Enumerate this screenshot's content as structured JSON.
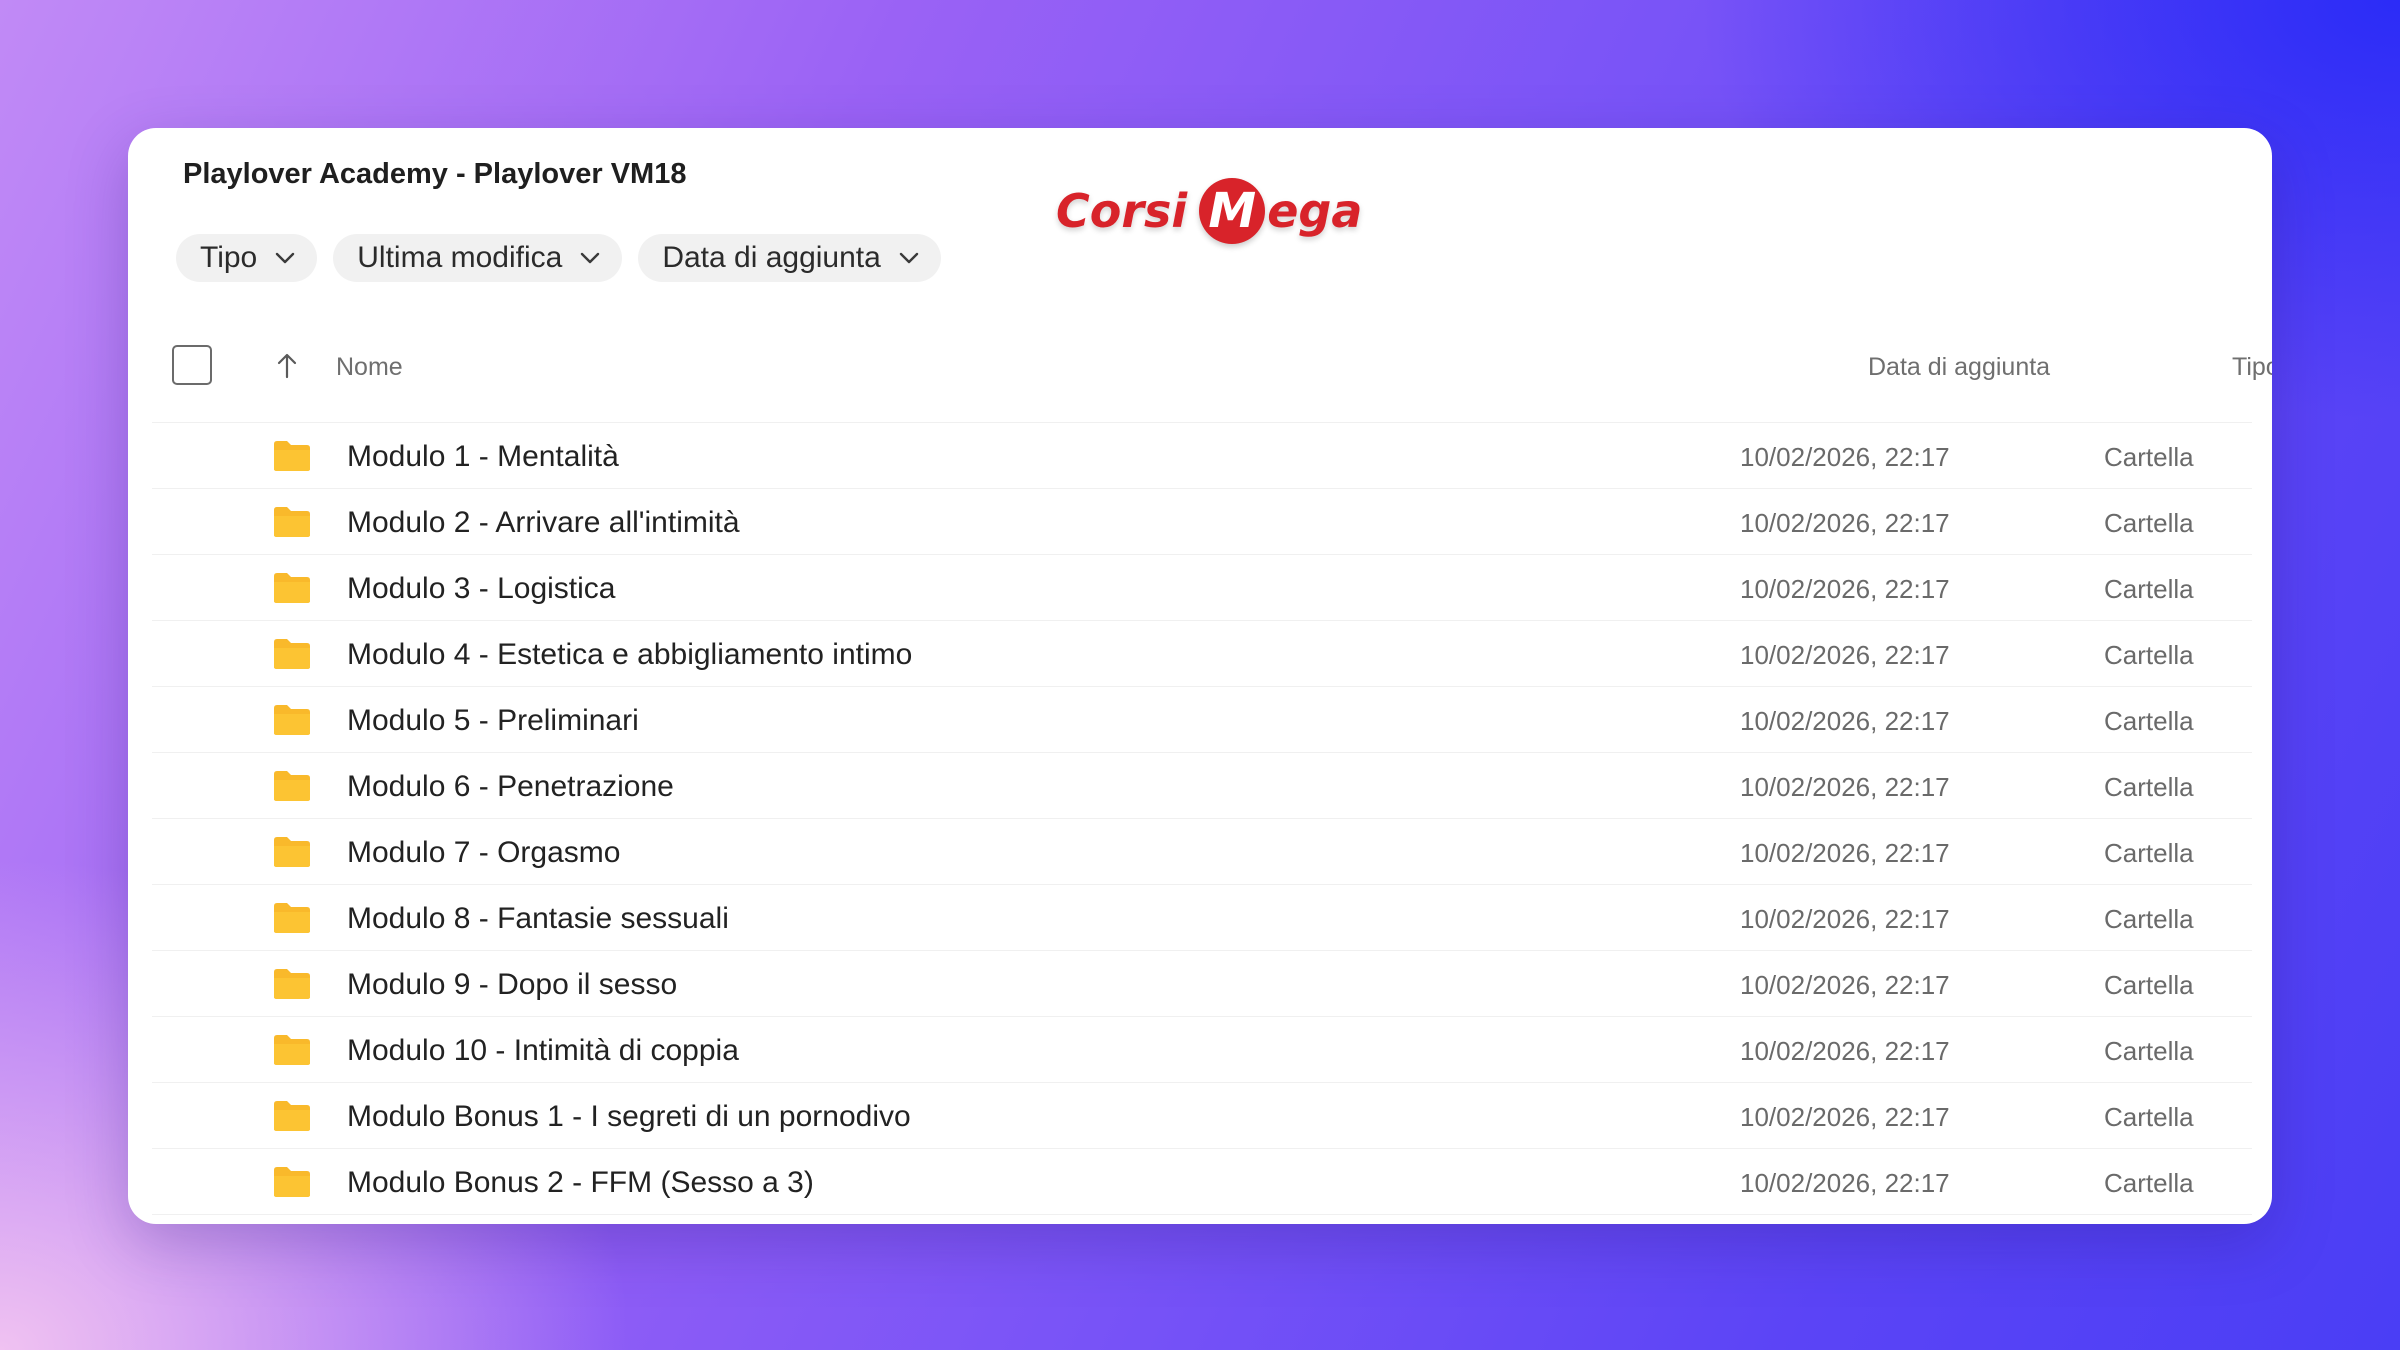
{
  "panel": {
    "title": "Playlover Academy - Playlover VM18"
  },
  "logo": {
    "word1": "Corsi",
    "m_letter": "M",
    "word2": "ega",
    "color": "#d8232a"
  },
  "filters": [
    {
      "label": "Tipo",
      "icon": "chevron-down-icon"
    },
    {
      "label": "Ultima modifica",
      "icon": "chevron-down-icon"
    },
    {
      "label": "Data di aggiunta",
      "icon": "chevron-down-icon"
    }
  ],
  "table": {
    "columns": {
      "name": "Nome",
      "date_added": "Data di aggiunta",
      "type": "Tipo"
    },
    "sort_icon": "arrow-up-icon",
    "rows": [
      {
        "name": "Modulo 1 - Mentalità",
        "date": "10/02/2026, 22:17",
        "type": "Cartella"
      },
      {
        "name": "Modulo 2 - Arrivare all'intimità",
        "date": "10/02/2026, 22:17",
        "type": "Cartella"
      },
      {
        "name": "Modulo 3 - Logistica",
        "date": "10/02/2026, 22:17",
        "type": "Cartella"
      },
      {
        "name": "Modulo 4 - Estetica e abbigliamento intimo",
        "date": "10/02/2026, 22:17",
        "type": "Cartella"
      },
      {
        "name": "Modulo 5 - Preliminari",
        "date": "10/02/2026, 22:17",
        "type": "Cartella"
      },
      {
        "name": "Modulo 6 - Penetrazione",
        "date": "10/02/2026, 22:17",
        "type": "Cartella"
      },
      {
        "name": "Modulo 7 - Orgasmo",
        "date": "10/02/2026, 22:17",
        "type": "Cartella"
      },
      {
        "name": "Modulo 8 - Fantasie sessuali",
        "date": "10/02/2026, 22:17",
        "type": "Cartella"
      },
      {
        "name": "Modulo 9 - Dopo il sesso",
        "date": "10/02/2026, 22:17",
        "type": "Cartella"
      },
      {
        "name": "Modulo 10 - Intimità di coppia",
        "date": "10/02/2026, 22:17",
        "type": "Cartella"
      },
      {
        "name": "Modulo Bonus 1 - I segreti di un pornodivo",
        "date": "10/02/2026, 22:17",
        "type": "Cartella"
      },
      {
        "name": "Modulo Bonus 2 - FFM (Sesso a 3)",
        "date": "10/02/2026, 22:17",
        "type": "Cartella"
      }
    ]
  },
  "colors": {
    "folder": "#f9b92b",
    "accent_logo": "#d8232a"
  }
}
